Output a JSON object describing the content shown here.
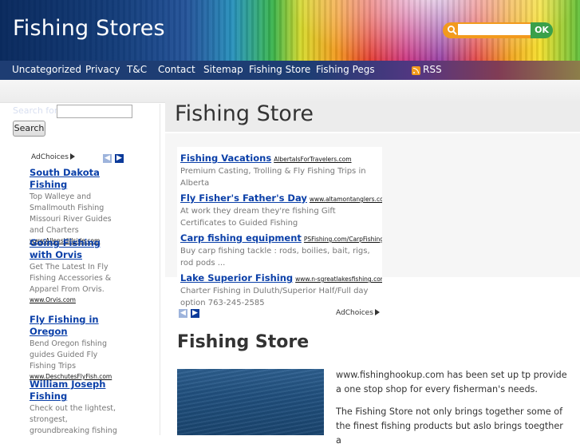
{
  "header": {
    "site_title": "Fishing Stores",
    "search_ok": "OK"
  },
  "nav": {
    "items": [
      "Uncategorized",
      "Privacy",
      "T&C",
      "Contact",
      "Sitemap",
      "Fishing Store",
      "Fishing Pegs"
    ],
    "rss": "RSS"
  },
  "sidebar": {
    "search_label": "Search for:",
    "search_button": "Search",
    "ad": {
      "adchoices": "AdChoices",
      "entries": [
        {
          "title": "South Dakota Fishing",
          "desc": "Top Walleye and Smallmouth Fishing Missouri River Guides and Charters",
          "url": "www.AllensHillside.com"
        },
        {
          "title": "Going Fishing with Orvis",
          "desc": "Get The Latest In Fly Fishing Accessories & Apparel From Orvis.",
          "url": "www.Orvis.com"
        },
        {
          "title": "Fly Fishing in Oregon",
          "desc": "Bend Oregon fishing guides Guided Fly Fishing Trips",
          "url": "www.DeschutesFlyFish.com"
        },
        {
          "title": "William Joseph Fishing",
          "desc": "Check out the lightest, strongest, groundbreaking fishing gear at",
          "url": ""
        }
      ]
    }
  },
  "main": {
    "page_title": "Fishing Store",
    "ad": {
      "adchoices": "AdChoices",
      "entries": [
        {
          "title": "Fishing Vacations",
          "url": "AlbertaIsForTravelers.com",
          "desc": "Premium Casting, Trolling & Fly Fishing Trips in Alberta"
        },
        {
          "title": "Fly Fisher's Father's Day",
          "url": "www.altamontanglers.com",
          "desc": "At work they dream they're fishing Gift Certificates to Guided Fishing"
        },
        {
          "title": "Carp fishing equipment",
          "url": "PSFishing.com/CarpFishing",
          "desc": "Buy carp fishing tackle : rods, boilies, bait, rigs, rod pods ..."
        },
        {
          "title": "Lake Superior Fishing",
          "url": "www.n-sgreatlakesfishing.com",
          "desc": "Charter Fishing in Duluth/Superior Half/Full day option 763-245-2585"
        }
      ]
    },
    "article": {
      "title": "Fishing Store",
      "paragraphs": [
        "www.fishinghookup.com has been set up tp provide a one stop shop for every fisherman's needs.",
        "The Fishing Store not only brings together some of the finest fishing products but aslo brings toegther a"
      ]
    }
  }
}
